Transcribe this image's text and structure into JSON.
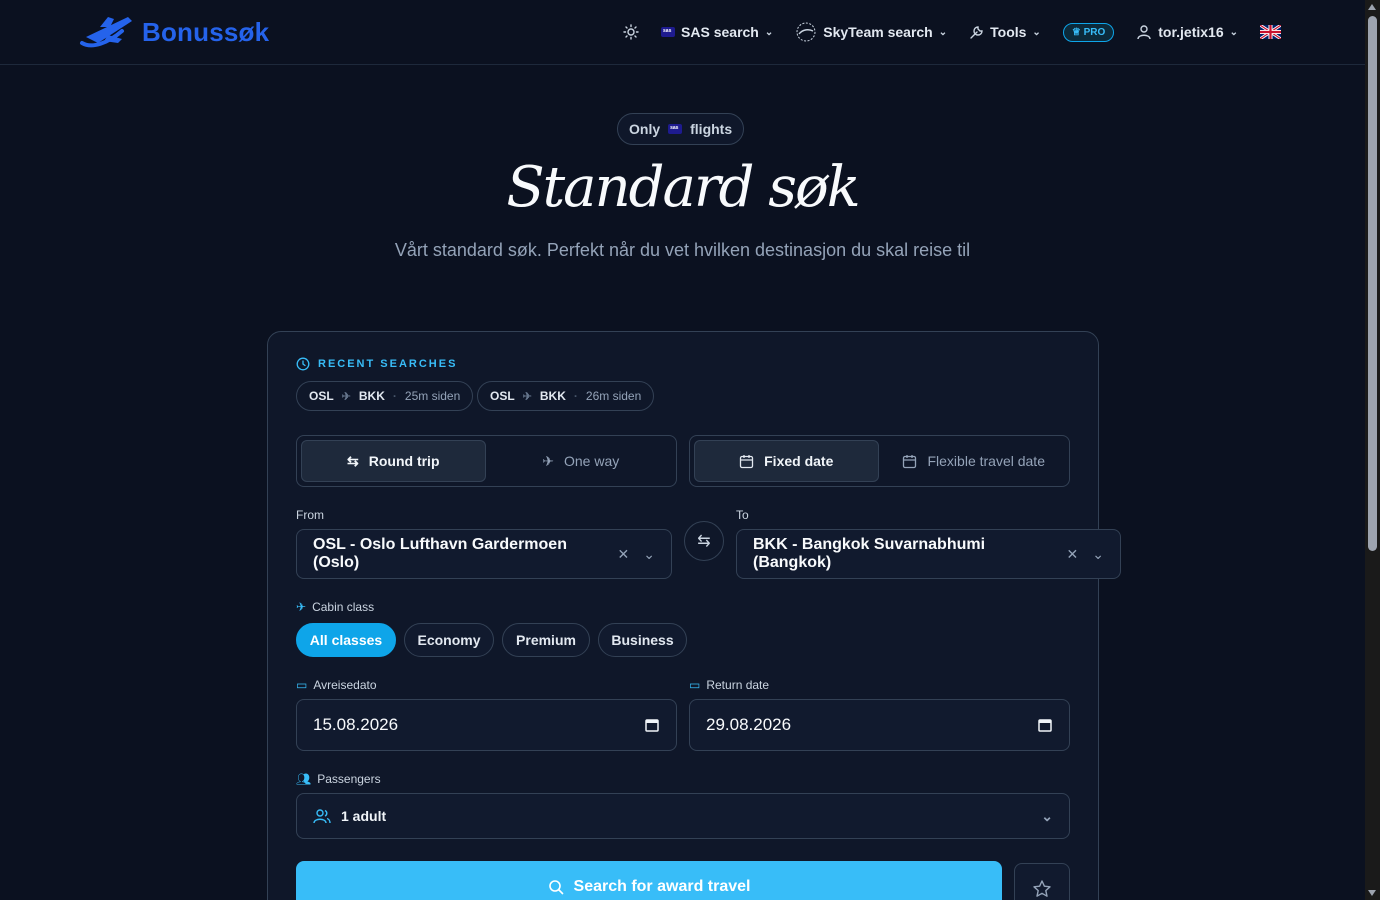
{
  "header": {
    "logo_text": "Bonussøk",
    "nav": {
      "sas_search": "SAS search",
      "skyteam_search": "SkyTeam search",
      "tools": "Tools",
      "pro_badge": "PRO",
      "username": "tor.jetix16"
    }
  },
  "hero": {
    "badge_prefix": "Only",
    "badge_suffix": "flights",
    "title": "Standard søk",
    "subtitle": "Vårt standard søk. Perfekt når du vet hvilken destinasjon du skal reise til"
  },
  "recent": {
    "label": "RECENT SEARCHES",
    "items": [
      {
        "from": "OSL",
        "to": "BKK",
        "ago": "25m siden"
      },
      {
        "from": "OSL",
        "to": "BKK",
        "ago": "26m siden"
      }
    ]
  },
  "trip_type": {
    "round_trip": "Round trip",
    "one_way": "One way",
    "selected": "Round trip"
  },
  "date_mode": {
    "fixed": "Fixed date",
    "flexible": "Flexible travel date",
    "selected": "Fixed date"
  },
  "route": {
    "from_label": "From",
    "from_value": "OSL - Oslo Lufthavn Gardermoen (Oslo)",
    "to_label": "To",
    "to_value": "BKK - Bangkok Suvarnabhumi (Bangkok)"
  },
  "cabin": {
    "label": "Cabin class",
    "options": [
      "All classes",
      "Economy",
      "Premium",
      "Business"
    ],
    "selected": "All classes"
  },
  "dates": {
    "departure_label": "Avreisedato",
    "departure_value": "15.08.2026",
    "return_label": "Return date",
    "return_value": "29.08.2026"
  },
  "passengers": {
    "label": "Passengers",
    "value": "1 adult"
  },
  "actions": {
    "search_label": "Search for award travel"
  },
  "colors": {
    "accent": "#38bdf8",
    "logo": "#2563eb",
    "background": "#0b1120"
  }
}
